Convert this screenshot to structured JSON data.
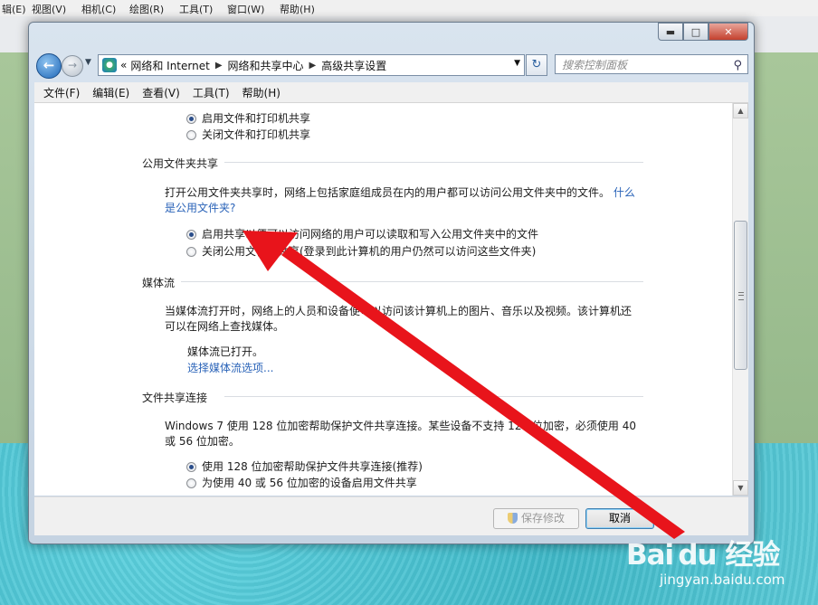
{
  "background_app": {
    "menus": [
      "辑(E)",
      "视图(V)",
      "相机(C)",
      "绘图(R)",
      "工具(T)",
      "窗口(W)",
      "帮助(H)"
    ]
  },
  "window": {
    "breadcrumb": {
      "lead": "«",
      "items": [
        "网络和 Internet",
        "网络和共享中心",
        "高级共享设置"
      ]
    },
    "search_placeholder": "搜索控制面板",
    "menu": [
      "文件(F)",
      "编辑(E)",
      "查看(V)",
      "工具(T)",
      "帮助(H)"
    ],
    "content": {
      "printer_on": "启用文件和打印机共享",
      "printer_off": "关闭文件和打印机共享",
      "public_title": "公用文件夹共享",
      "public_desc": "打开公用文件夹共享时，网络上包括家庭组成员在内的用户都可以访问公用文件夹中的文件。",
      "public_link1": "什么",
      "public_link2": "是公用文件夹?",
      "public_on": "启用共享以便可以访问网络的用户可以读取和写入公用文件夹中的文件",
      "public_off": "关闭公用文件夹共享(登录到此计算机的用户仍然可以访问这些文件夹)",
      "media_title": "媒体流",
      "media_desc1": "当媒体流打开时，网络上的人员和设备便可以访问该计算机上的图片、音乐以及视频。该计算机还",
      "media_desc2": "可以在网络上查找媒体。",
      "media_status": "媒体流已打开。",
      "media_link": "选择媒体流选项...",
      "conn_title": "文件共享连接",
      "conn_desc1": "Windows 7 使用 128 位加密帮助保护文件共享连接。某些设备不支持 128 位加密，必须使用 40",
      "conn_desc2": "或 56 位加密。",
      "conn_128": "使用 128 位加密帮助保护文件共享连接(推荐)",
      "conn_40": "为使用 40 或 56 位加密的设备启用文件共享"
    },
    "buttons": {
      "save": "保存修改",
      "cancel": "取消"
    }
  },
  "watermark": {
    "line1": "Bai du 经验",
    "line2": "jingyan.baidu.com"
  },
  "colors": {
    "annotation_arrow": "#e8141b",
    "link": "#2a63b8",
    "accent": "#1d66b8"
  },
  "icons": [
    "back-arrow-icon",
    "forward-arrow-icon",
    "control-panel-icon",
    "refresh-icon",
    "search-icon",
    "shield-icon",
    "minimize-icon",
    "maximize-icon",
    "close-icon"
  ]
}
